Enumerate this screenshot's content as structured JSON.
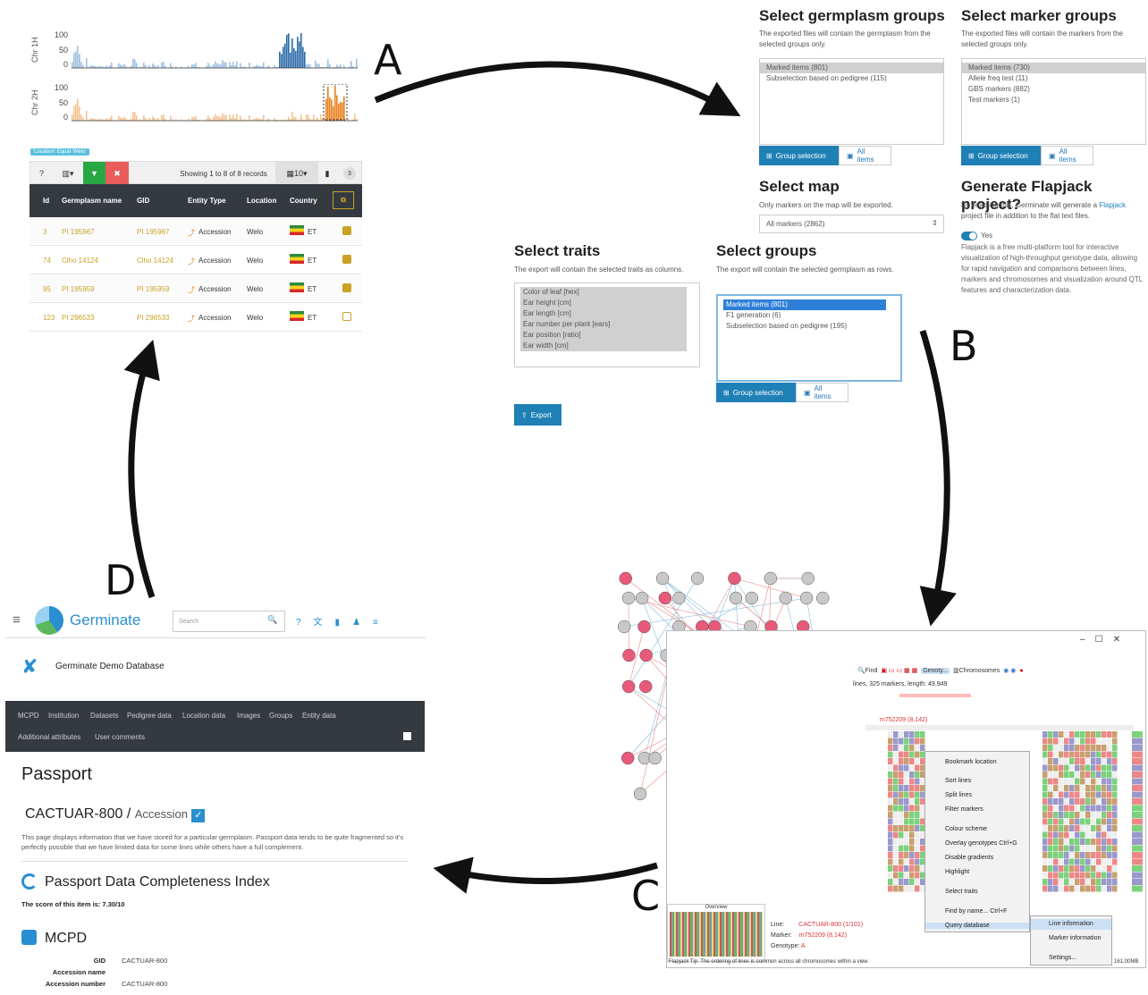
{
  "letters": {
    "a": "A",
    "b": "B",
    "c": "C",
    "d": "D"
  },
  "charts": [
    {
      "label": "Chr 1H",
      "ticks": [
        "100",
        "50",
        "0"
      ],
      "color": "#2d6aa8",
      "light": "#9fc0e2"
    },
    {
      "label": "Chr 2H",
      "ticks": [
        "100",
        "50",
        "0"
      ],
      "color": "#e8801e",
      "light": "#f5c392"
    }
  ],
  "table": {
    "filter_chip": "'Location' Equal 'Welo'",
    "showing": "Showing 1 to 8 of 8 records",
    "page_size": "10",
    "badge": "3",
    "columns": [
      "Id",
      "Germplasm name",
      "GID",
      "Entity Type",
      "Location",
      "Country"
    ],
    "rows": [
      {
        "id": "3",
        "name": "PI 195967",
        "gid": "PI 195967",
        "type": "Accession",
        "location": "Welo",
        "country": "ET",
        "checked": true
      },
      {
        "id": "74",
        "name": "Clho 14124",
        "gid": "Clho 14124",
        "type": "Accession",
        "location": "Welo",
        "country": "ET",
        "checked": true
      },
      {
        "id": "95",
        "name": "PI 195959",
        "gid": "PI 195959",
        "type": "Accession",
        "location": "Welo",
        "country": "ET",
        "checked": true
      },
      {
        "id": "123",
        "name": "PI 296533",
        "gid": "PI 296533",
        "type": "Accession",
        "location": "Welo",
        "country": "ET",
        "checked": false
      }
    ]
  },
  "export": {
    "germplasm_groups": {
      "title": "Select germplasm groups",
      "desc": "The exported files will contain the germplasm from the selected groups only.",
      "items": [
        "Marked items (801)",
        "Subselection based on pedigree (115)"
      ]
    },
    "marker_groups": {
      "title": "Select marker groups",
      "desc": "The exported files will contain the markers from the selected groups only.",
      "items": [
        "Marked items (730)",
        "Allele freq test (11)",
        "GBS markers (882)",
        "Test markers (1)"
      ]
    },
    "group_selection": "Group selection",
    "all_items": "All items",
    "map": {
      "title": "Select map",
      "desc": "Only markers on the map will be exported.",
      "value": "All markers (2862)"
    },
    "flapjack": {
      "title": "Generate Flapjack project?",
      "desc1": "By enabling this, Germinate will generate a",
      "link": "Flapjack",
      "desc2": "project file in addition to the flat text files.",
      "toggle": "Yes",
      "info": "Flapjack is a free multi-platform tool for interactive visualization of high-throughput genotype data, allowing for rapid navigation and comparisons between lines, markers and chromosomes and visualization around QTL features and characterization data."
    },
    "traits": {
      "title": "Select traits",
      "desc": "The export will contain the selected traits as columns.",
      "items": [
        "Color of leaf [hex]",
        "Ear height [cm]",
        "Ear length [cm]",
        "Ear number per plant [ears]",
        "Ear position [ratio]",
        "Ear width [cm]"
      ]
    },
    "groups": {
      "title": "Select groups",
      "desc": "The export will contain the selected germplasm as rows.",
      "items": [
        "Marked items (801)",
        "F1 generation (6)",
        "Subselection based on pedigree (195)"
      ]
    },
    "export_btn": "Export"
  },
  "germinate": {
    "brand": "Germinate",
    "search": "Search",
    "db": "Germinate Demo Database",
    "nav": [
      "MCPD",
      "Institution",
      "Datasets",
      "Pedigree data",
      "Location data",
      "Images",
      "Groups",
      "Entity data",
      "Additional attributes",
      "User comments"
    ],
    "passport": "Passport",
    "item": "CACTUAR-800",
    "sep": "/",
    "type": "Accession",
    "desc": "This page displays information that we have stored for a particular germplasm. Passport data tends to be quite fragmented so it's perfectly possible that we have limited data for some lines while others have a full complement.",
    "pdci": "Passport Data Completeness Index",
    "score": "The score of this item is: 7.30/10",
    "mcpd": "MCPD",
    "fields": [
      {
        "k": "GID",
        "v": "CACTUAR-800"
      },
      {
        "k": "Accession name",
        "v": ""
      },
      {
        "k": "Accession number",
        "v": "CACTUAR-800"
      }
    ]
  },
  "flapjack": {
    "find": "Find",
    "genotypes": "Genoty...",
    "chromosomes": "Chromosomes",
    "status": "lines, 325 markers, length: 49,949",
    "marker": "m752209 (8,142)",
    "menu": [
      "Bookmark location",
      "Sort lines",
      "Split lines",
      "Filter markers",
      "Colour scheme",
      "Overlay genotypes  Ctrl+G",
      "Disable gradients",
      "Highlight",
      "Select traits",
      "Find by name...     Ctrl+F",
      "Query database"
    ],
    "submenu": [
      "Line information",
      "Marker information",
      "Settings..."
    ],
    "overview": "Overview",
    "line_l": "Line:",
    "line_v": "CACTUAR-800 (1/101)",
    "marker_l": "Marker:",
    "marker_v": "m752209 (8,142)",
    "geno_l": "Genotype:",
    "geno_v": "A",
    "tip": "Flapjack Tip:  The ordering of lines is common across all chromosomes within a view",
    "mem": "161.00MB"
  }
}
